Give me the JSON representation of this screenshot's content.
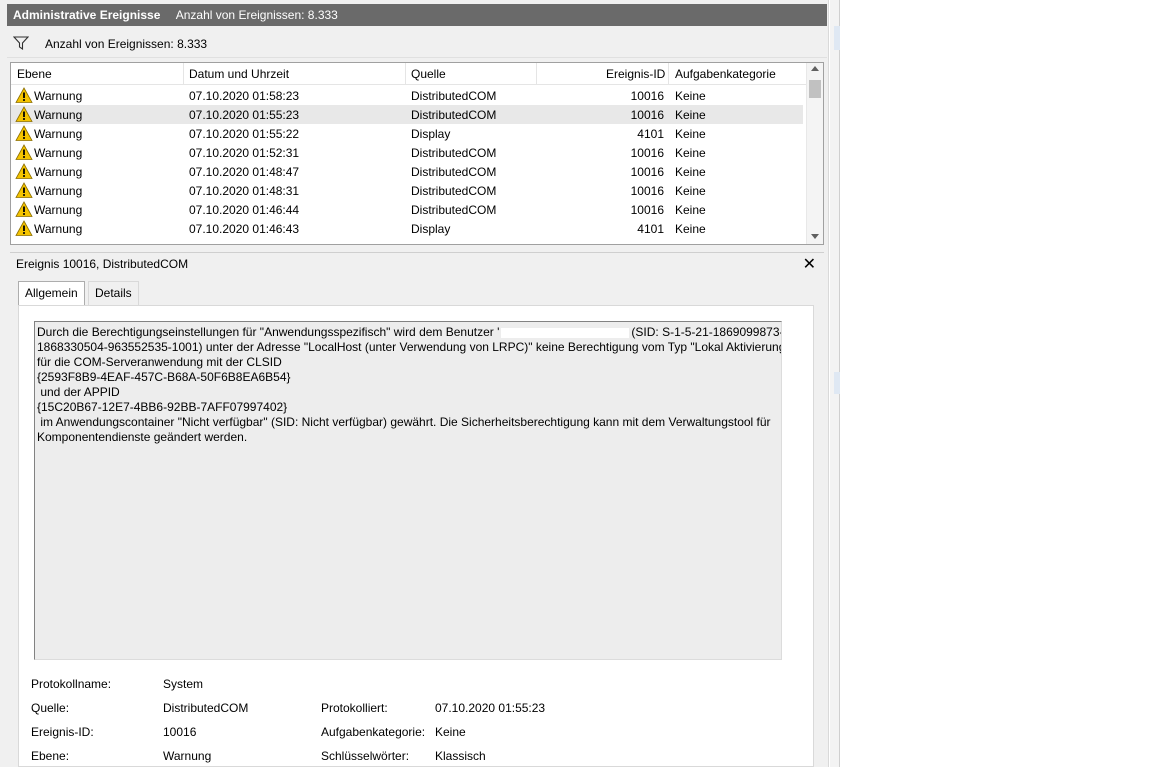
{
  "title_bar": {
    "title": "Administrative Ereignisse",
    "count": "Anzahl von Ereignissen: 8.333"
  },
  "filter_bar": {
    "icon": "filter-icon",
    "text": "Anzahl von Ereignissen: 8.333"
  },
  "grid": {
    "headers": {
      "level": "Ebene",
      "datetime": "Datum und Uhrzeit",
      "source": "Quelle",
      "event_id": "Ereignis-ID",
      "category": "Aufgabenkategorie"
    },
    "rows": [
      {
        "level": "Warnung",
        "datetime": "07.10.2020 01:58:23",
        "source": "DistributedCOM",
        "event_id": "10016",
        "category": "Keine"
      },
      {
        "level": "Warnung",
        "datetime": "07.10.2020 01:55:23",
        "source": "DistributedCOM",
        "event_id": "10016",
        "category": "Keine",
        "selected": true
      },
      {
        "level": "Warnung",
        "datetime": "07.10.2020 01:55:22",
        "source": "Display",
        "event_id": "4101",
        "category": "Keine"
      },
      {
        "level": "Warnung",
        "datetime": "07.10.2020 01:52:31",
        "source": "DistributedCOM",
        "event_id": "10016",
        "category": "Keine"
      },
      {
        "level": "Warnung",
        "datetime": "07.10.2020 01:48:47",
        "source": "DistributedCOM",
        "event_id": "10016",
        "category": "Keine"
      },
      {
        "level": "Warnung",
        "datetime": "07.10.2020 01:48:31",
        "source": "DistributedCOM",
        "event_id": "10016",
        "category": "Keine"
      },
      {
        "level": "Warnung",
        "datetime": "07.10.2020 01:46:44",
        "source": "DistributedCOM",
        "event_id": "10016",
        "category": "Keine"
      },
      {
        "level": "Warnung",
        "datetime": "07.10.2020 01:46:43",
        "source": "Display",
        "event_id": "4101",
        "category": "Keine"
      }
    ]
  },
  "detail": {
    "title": "Ereignis 10016, DistributedCOM",
    "close": "✕",
    "tabs": [
      "Allgemein",
      "Details"
    ],
    "description": {
      "line1_before": "Durch die Berechtigungseinstellungen für \"Anwendungsspezifisch\" wird dem Benutzer '",
      "line1_after": "(SID: S-1-5-21-1869099873-",
      "lines": [
        "1868330504-963552535-1001) unter der Adresse \"LocalHost (unter Verwendung von LRPC)\" keine Berechtigung vom Typ \"Lokal Aktivierung\"",
        "für die COM-Serveranwendung mit der CLSID",
        "{2593F8B9-4EAF-457C-B68A-50F6B8EA6B54}",
        " und der APPID",
        "{15C20B67-12E7-4BB6-92BB-7AFF07997402}",
        " im Anwendungscontainer \"Nicht verfügbar\" (SID: Nicht verfügbar) gewährt. Die Sicherheitsberechtigung kann mit dem Verwaltungstool für",
        "Komponentendienste geändert werden."
      ]
    },
    "props": {
      "log_name_label": "Protokollname:",
      "log_name": "System",
      "source_label": "Quelle:",
      "source": "DistributedCOM",
      "logged_label": "Protokolliert:",
      "logged": "07.10.2020 01:55:23",
      "event_id_label": "Ereignis-ID:",
      "event_id": "10016",
      "category_label": "Aufgabenkategorie:",
      "category": "Keine",
      "level_label": "Ebene:",
      "level": "Warnung",
      "keywords_label": "Schlüsselwörter:",
      "keywords": "Klassisch"
    }
  },
  "colors": {
    "title_bar": "#6a6a6a",
    "selected_row": "#e8e8e8",
    "warning_icon": "#f5c400"
  }
}
